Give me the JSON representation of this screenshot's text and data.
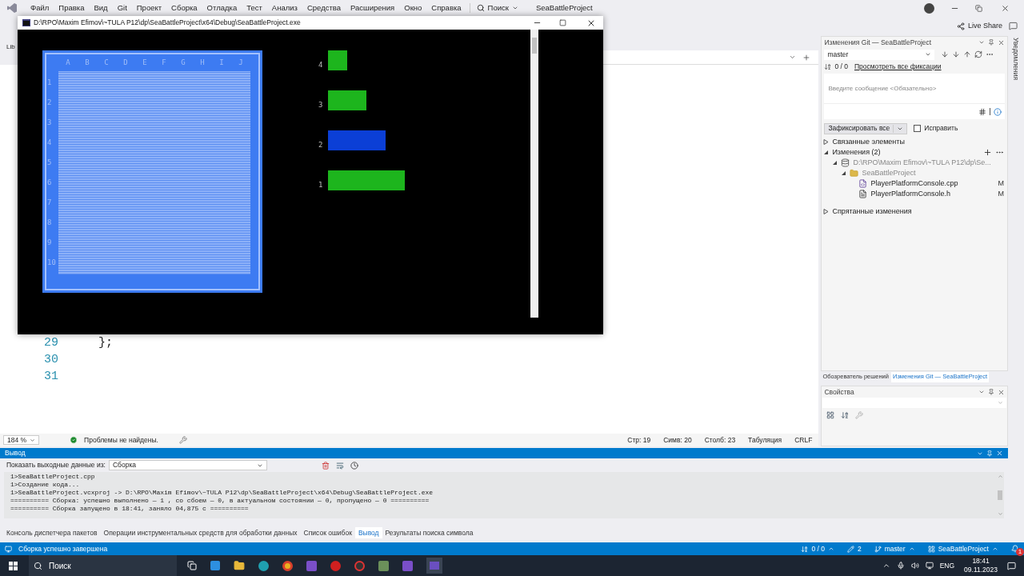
{
  "menu": [
    "Файл",
    "Правка",
    "Вид",
    "Git",
    "Проект",
    "Сборка",
    "Отладка",
    "Тест",
    "Анализ",
    "Средства",
    "Расширения",
    "Окно",
    "Справка"
  ],
  "menu_search": "Поиск",
  "solution_title": "SeaBattleProject",
  "live_share": "Live Share",
  "editor": {
    "tab_fragment": "Lib",
    "lines": [
      {
        "number": "29",
        "code": "};"
      },
      {
        "number": "30"
      },
      {
        "number": "31"
      }
    ],
    "status": {
      "zoom": "184 %",
      "issues": "Проблемы не найдены.",
      "position": [
        "Стр: 19",
        "Симв: 20",
        "Столб: 23",
        "Табуляция",
        "CRLF"
      ]
    }
  },
  "console": {
    "title": "D:\\RPO\\Maxim Efimov\\~TULA P12\\dp\\SeaBattleProject\\x64\\Debug\\SeaBattleProject.exe",
    "columns": [
      "A",
      "B",
      "C",
      "D",
      "E",
      "F",
      "G",
      "H",
      "I",
      "J"
    ],
    "rows": [
      "1",
      "2",
      "3",
      "4",
      "5",
      "6",
      "7",
      "8",
      "9",
      "10"
    ],
    "ships": [
      {
        "label": "4",
        "color": "#1db51d"
      },
      {
        "label": "3",
        "color": "#1db51d"
      },
      {
        "label": "2",
        "color": "#0b3fd6"
      },
      {
        "label": "1",
        "color": "#1db51d"
      }
    ]
  },
  "git": {
    "title": "Изменения Git — SeaBattleProject",
    "branch": "master",
    "sync": "0 / 0",
    "history_link": "Просмотреть все фиксации",
    "message_placeholder": "Введите сообщение <Обязательно>",
    "commit_button": "Зафиксировать все",
    "amend": {
      "label": "Исправить",
      "checked": false
    },
    "tree": [
      {
        "label": "Связанные элементы",
        "kind": "section",
        "expanded": false
      },
      {
        "label": "Изменения (2)",
        "kind": "section",
        "expanded": true,
        "children": [
          {
            "label": "D:\\RPO\\Maxim Efimov\\~TULA P12\\dp\\Se...",
            "kind": "repo",
            "expanded": true,
            "children": [
              {
                "label": "SeaBattleProject",
                "kind": "folder",
                "expanded": true,
                "children": [
                  {
                    "label": "PlayerPlatformConsole.cpp",
                    "kind": "cpp",
                    "status": "M"
                  },
                  {
                    "label": "PlayerPlatformConsole.h",
                    "kind": "header",
                    "status": "M"
                  }
                ]
              }
            ]
          }
        ]
      },
      {
        "label": "Спрятанные изменения",
        "kind": "section",
        "expanded": false
      }
    ]
  },
  "right_tabs": [
    {
      "label": "Обозреватель решений",
      "selected": false
    },
    {
      "label": "Изменения Git — SeaBattleProject",
      "selected": true
    }
  ],
  "properties_title": "Свойства",
  "notifications_tab": "Уведомления",
  "output": {
    "title": "Вывод",
    "source_label": "Показать выходные данные из:",
    "source": "Сборка",
    "lines": [
      "1>SeaBattleProject.cpp",
      "1>Создание кода...",
      "1>SeaBattleProject.vcxproj -> D:\\RPO\\Maxim Efimov\\~TULA P12\\dp\\SeaBattleProject\\x64\\Debug\\SeaBattleProject.exe",
      "========== Сборка: успешно выполнено — 1 , со сбоем — 0, в актуальном состоянии — 0, пропущено — 0 ==========",
      "========== Сборка запущено в 18:41, заняло 04,875 с =========="
    ],
    "tabs": [
      {
        "label": "Консоль диспетчера пакетов",
        "selected": false
      },
      {
        "label": "Операции инструментальных средств для обработки данных",
        "selected": false
      },
      {
        "label": "Список ошибок",
        "selected": false
      },
      {
        "label": "Вывод",
        "selected": true
      },
      {
        "label": "Результаты поиска символа",
        "selected": false
      }
    ]
  },
  "status_bar": {
    "message": "Сборка успешно завершена",
    "sync": "0 / 0",
    "changes": "2",
    "branch": "master",
    "repo": "SeaBattleProject",
    "notifications": "1"
  },
  "taskbar": {
    "search": "Поиск",
    "language": "ENG",
    "time": "18:41",
    "date": "09.11.2023"
  }
}
